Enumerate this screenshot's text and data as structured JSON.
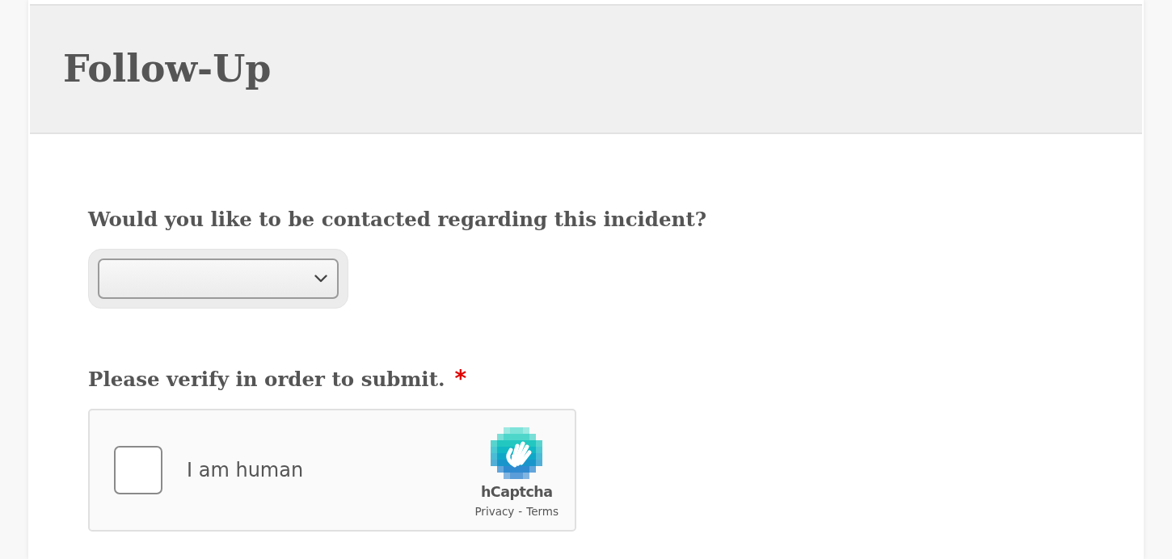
{
  "header": {
    "title": "Follow-Up"
  },
  "required_mark": "*",
  "fields": [
    {
      "kind": "select",
      "label": "Would you like to be contacted regarding this incident?",
      "required": false
    },
    {
      "kind": "captcha",
      "label": "Please verify in order to submit.",
      "required": true
    }
  ],
  "captcha": {
    "checked": false,
    "label": "I am human",
    "brand": "hCaptcha",
    "links": [
      "Privacy",
      "Terms"
    ],
    "separator": "-"
  }
}
